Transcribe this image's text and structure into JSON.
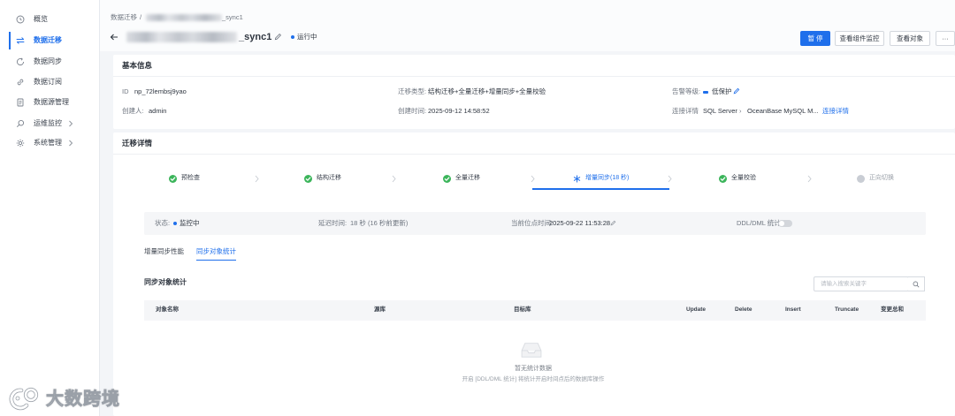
{
  "colors": {
    "accent": "#1f6feb",
    "success": "#3cb55b",
    "pending": "#c9cdd4",
    "page_bg": "#f3f5f8",
    "text": "#2f3640",
    "muted": "#6f7680"
  },
  "sidebar": {
    "active_index": 1,
    "items": [
      {
        "label": "概览",
        "icon": "overview-icon"
      },
      {
        "label": "数据迁移",
        "icon": "migration-icon"
      },
      {
        "label": "数据同步",
        "icon": "sync-icon"
      },
      {
        "label": "数据订阅",
        "icon": "subscribe-icon"
      },
      {
        "label": "数据源管理",
        "icon": "datasource-icon"
      },
      {
        "label": "运维监控",
        "icon": "ops-monitor-icon",
        "has_children": true
      },
      {
        "label": "系统管理",
        "icon": "system-settings-icon",
        "has_children": true
      }
    ]
  },
  "breadcrumb": {
    "root": "数据迁移",
    "separator": "/",
    "current": "_sync1"
  },
  "header": {
    "title": "_sync1",
    "status": "运行中",
    "buttons": {
      "pause": "暂 停",
      "component_monitor": "查看组件监控",
      "view_objects": "查看对象",
      "more": "···"
    }
  },
  "basic_info": {
    "title": "基本信息",
    "id_label": "ID",
    "id_value": "np_72lembsj9yao",
    "type_label": "迁移类型:",
    "type_value": "结构迁移+全量迁移+增量同步+全量校验",
    "alert_label": "告警等级:",
    "alert_value": "低保护",
    "creator_label": "创建人:",
    "creator_value": "admin",
    "created_label": "创建时间:",
    "created_value": "2025-09-12 14:58:52",
    "conn_label": "连接详情",
    "conn_source": "SQL Server",
    "conn_arrow": "›",
    "conn_target": "OceanBase MySQL M...",
    "conn_link": "连接详情"
  },
  "migration": {
    "title": "迁移详情",
    "steps": [
      {
        "label": "预检查",
        "done": true,
        "current": false
      },
      {
        "label": "结构迁移",
        "done": true,
        "current": false
      },
      {
        "label": "全量迁移",
        "done": true,
        "current": false
      },
      {
        "label": "增量同步(18 秒)",
        "done": false,
        "current": true
      },
      {
        "label": "全量校验",
        "done": true,
        "current": false
      },
      {
        "label": "正向切换",
        "done": false,
        "current": false
      }
    ],
    "status_bar": {
      "status_label": "状态:",
      "status_value": "监控中",
      "delay_label": "延迟时间:",
      "delay_value": "18 秒 (16 秒前更新)",
      "position_label": "当前位点时间:",
      "position_value": "2025-09-22 11:53:28",
      "ddl_label": "DDL/DML 统计:",
      "ddl_enabled": false
    },
    "active_tab": 1,
    "tabs": [
      {
        "label": "增量同步性能"
      },
      {
        "label": "同步对象统计"
      }
    ],
    "object_stats": {
      "title": "同步对象统计",
      "search_placeholder": "请输入搜索关键字",
      "columns": [
        "对象名称",
        "源库",
        "目标库",
        "Update",
        "Delete",
        "Insert",
        "Truncate",
        "变更总和"
      ],
      "rows": [],
      "empty_title": "暂无统计数据",
      "empty_desc": "开启 [DDL/DML 统计] 将统计开启时间点后的数据库操作"
    }
  },
  "watermark": {
    "text": "大数跨境"
  }
}
